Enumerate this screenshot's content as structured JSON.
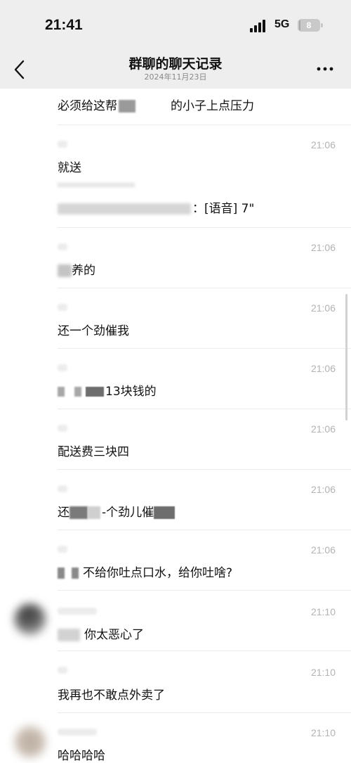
{
  "status": {
    "time": "21:41",
    "network": "5G",
    "battery": "8",
    "battery_level": 0.08
  },
  "header": {
    "title": "群聊的聊天记录",
    "date": "2024年11月23日"
  },
  "icons": {
    "back": "chevron-left-icon",
    "more": "more-horizontal-icon",
    "signal": "signal-icon",
    "battery": "battery-icon"
  },
  "messages": [
    {
      "text_a": "必须给这帮",
      "text_b": "的小子上点压力",
      "time": ""
    },
    {
      "text": "就送",
      "time": "21:06"
    },
    {
      "text": "：[语音] 7\"",
      "time": ""
    },
    {
      "text": "养的",
      "time": "21:06"
    },
    {
      "text": "还一个劲催我",
      "time": "21:06"
    },
    {
      "text": "13块钱的",
      "time": "21:06"
    },
    {
      "text": "配送费三块四",
      "time": "21:06"
    },
    {
      "text_a": "还",
      "text_b": "-个劲儿催",
      "time": "21:06"
    },
    {
      "text": "不给你吐点口水，给你吐啥?",
      "time": "21:06"
    },
    {
      "text": "你太恶心了",
      "time": "21:10"
    },
    {
      "text": "我再也不敢点外卖了",
      "time": "21:10"
    },
    {
      "text": "哈哈哈哈",
      "time": "21:10"
    }
  ]
}
